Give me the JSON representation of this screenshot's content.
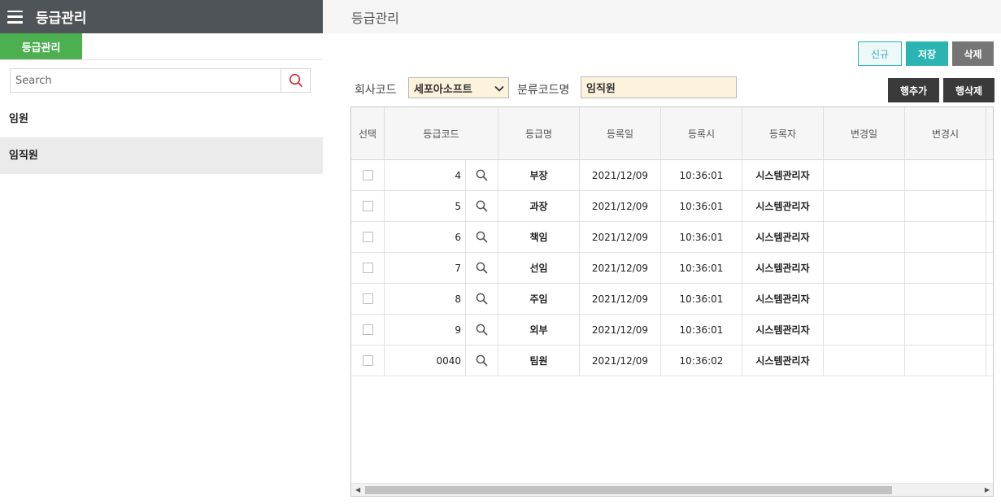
{
  "sidebar": {
    "title": "등급관리",
    "tab_label": "등급관리",
    "search_placeholder": "Search",
    "items": [
      {
        "label": "임원"
      },
      {
        "label": "임직원"
      }
    ]
  },
  "main": {
    "title": "등급관리",
    "buttons": {
      "new": "신규",
      "save": "저장",
      "delete": "삭제",
      "add_row": "행추가",
      "delete_row": "행삭제"
    },
    "form": {
      "company_label": "회사코드",
      "company_value": "세포아소프트",
      "class_label": "분류코드명",
      "class_value": "임직원"
    },
    "grid": {
      "headers": [
        "선택",
        "등급코드",
        "등급명",
        "등록일",
        "등록시",
        "등록자",
        "변경일",
        "변경시"
      ],
      "rows": [
        {
          "code": "4",
          "name": "부장",
          "reg_date": "2021/12/09",
          "reg_time": "10:36:01",
          "reg_user": "시스템관리자",
          "mod_date": "",
          "mod_time": ""
        },
        {
          "code": "5",
          "name": "과장",
          "reg_date": "2021/12/09",
          "reg_time": "10:36:01",
          "reg_user": "시스템관리자",
          "mod_date": "",
          "mod_time": ""
        },
        {
          "code": "6",
          "name": "책임",
          "reg_date": "2021/12/09",
          "reg_time": "10:36:01",
          "reg_user": "시스템관리자",
          "mod_date": "",
          "mod_time": ""
        },
        {
          "code": "7",
          "name": "선임",
          "reg_date": "2021/12/09",
          "reg_time": "10:36:01",
          "reg_user": "시스템관리자",
          "mod_date": "",
          "mod_time": ""
        },
        {
          "code": "8",
          "name": "주임",
          "reg_date": "2021/12/09",
          "reg_time": "10:36:01",
          "reg_user": "시스템관리자",
          "mod_date": "",
          "mod_time": ""
        },
        {
          "code": "9",
          "name": "외부",
          "reg_date": "2021/12/09",
          "reg_time": "10:36:01",
          "reg_user": "시스템관리자",
          "mod_date": "",
          "mod_time": ""
        },
        {
          "code": "0040",
          "name": "팀원",
          "reg_date": "2021/12/09",
          "reg_time": "10:36:02",
          "reg_user": "시스템관리자",
          "mod_date": "",
          "mod_time": ""
        }
      ]
    }
  },
  "colors": {
    "header_bg": "#4f5459",
    "tab_green": "#4caf50",
    "teal": "#2bb5b2",
    "input_bg": "#fdf2dc",
    "dark_button": "#3a3a3a",
    "gray_button": "#757575"
  },
  "icons": [
    "hamburger-icon",
    "search-icon",
    "magnifier-icon",
    "chevron-down-icon",
    "scroll-left-icon",
    "scroll-right-icon"
  ]
}
